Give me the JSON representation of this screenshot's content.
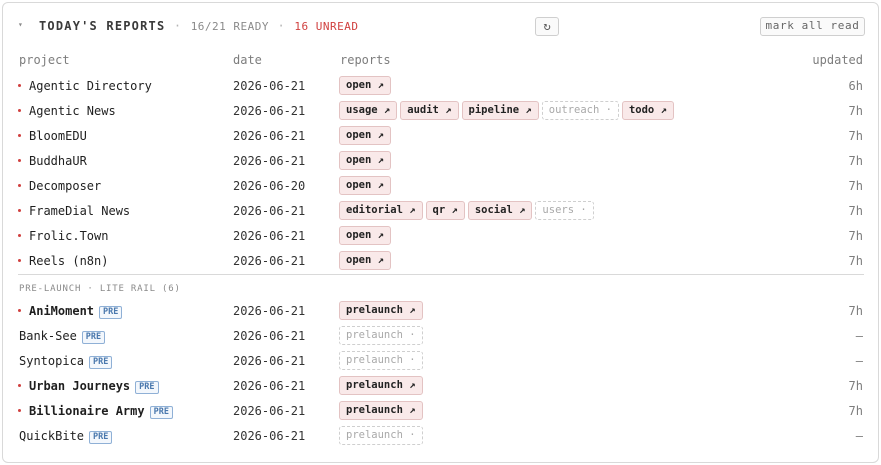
{
  "header": {
    "caret": "▾",
    "title": "TODAY'S REPORTS",
    "sep1": "·",
    "ready": "16/21 READY",
    "sep2": "·",
    "unread": "16 UNREAD",
    "refresh_icon": "↻",
    "mark_all_label": "mark all read"
  },
  "columns": {
    "project": "project",
    "date": "date",
    "reports": "reports",
    "updated": "updated"
  },
  "projects": [
    {
      "name": "Agentic Directory",
      "date": "2026-06-21",
      "updated": "6h",
      "chips": [
        {
          "label": "open ↗"
        }
      ]
    },
    {
      "name": "Agentic News",
      "date": "2026-06-21",
      "updated": "7h",
      "chips": [
        {
          "label": "usage ↗"
        },
        {
          "label": "audit ↗"
        },
        {
          "label": "pipeline ↗"
        },
        {
          "label": "outreach ·"
        },
        {
          "label": "todo ↗"
        }
      ]
    },
    {
      "name": "BloomEDU",
      "date": "2026-06-21",
      "updated": "7h",
      "chips": [
        {
          "label": "open ↗"
        }
      ]
    },
    {
      "name": "BuddhaUR",
      "date": "2026-06-21",
      "updated": "7h",
      "chips": [
        {
          "label": "open ↗"
        }
      ]
    },
    {
      "name": "Decomposer",
      "date": "2026-06-20",
      "updated": "7h",
      "chips": [
        {
          "label": "open ↗"
        }
      ]
    },
    {
      "name": "FrameDial News",
      "date": "2026-06-21",
      "updated": "7h",
      "chips": [
        {
          "label": "editorial ↗"
        },
        {
          "label": "qr ↗"
        },
        {
          "label": "social ↗"
        },
        {
          "label": "users ·"
        }
      ]
    },
    {
      "name": "Frolic.Town",
      "date": "2026-06-21",
      "updated": "7h",
      "chips": [
        {
          "label": "open ↗"
        }
      ]
    },
    {
      "name": "Reels (n8n)",
      "date": "2026-06-21",
      "updated": "7h",
      "chips": [
        {
          "label": "open ↗"
        }
      ]
    }
  ],
  "prelaunch_section": {
    "label": "PRE-LAUNCH · LITE RAIL (6)",
    "badge": "PRE",
    "projects": [
      {
        "name": "AniMoment",
        "date": "2026-06-21",
        "updated": "7h",
        "chip": "prelaunch ↗"
      },
      {
        "name": "Bank-See",
        "date": "2026-06-21",
        "updated": "—",
        "chip": "prelaunch ·"
      },
      {
        "name": "Syntopica",
        "date": "2026-06-21",
        "updated": "—",
        "chip": "prelaunch ·"
      },
      {
        "name": "Urban Journeys",
        "date": "2026-06-21",
        "updated": "7h",
        "chip": "prelaunch ↗"
      },
      {
        "name": "Billionaire Army",
        "date": "2026-06-21",
        "updated": "7h",
        "chip": "prelaunch ↗"
      },
      {
        "name": "QuickBite",
        "date": "2026-06-21",
        "updated": "—",
        "chip": "prelaunch ·"
      }
    ]
  },
  "colors": {
    "accent_red": "#d0403f",
    "chip_bg": "#f9e9e9",
    "badge_blue": "#4a78ad"
  }
}
